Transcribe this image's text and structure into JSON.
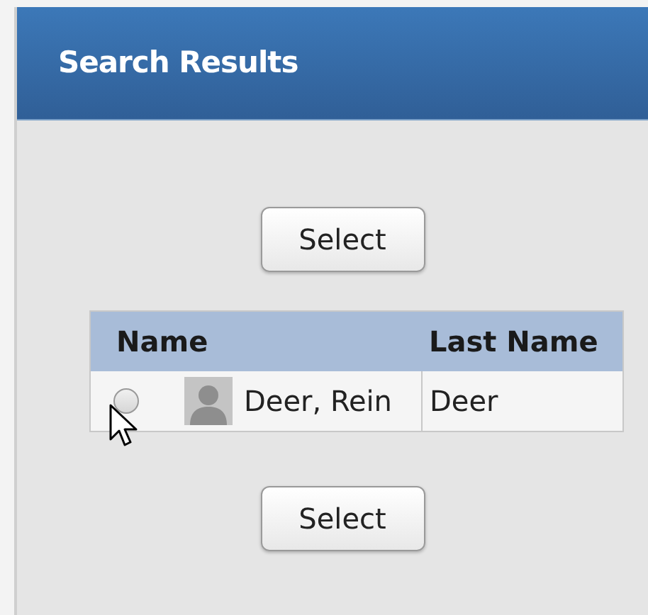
{
  "header": {
    "title": "Search Results"
  },
  "buttons": [
    {
      "label": "Select"
    },
    {
      "label": "Select"
    }
  ],
  "table": {
    "columns": [
      "Name",
      "Last Name"
    ],
    "rows": [
      {
        "selected": false,
        "name": "Deer, Rein",
        "last_name": "Deer"
      }
    ]
  }
}
